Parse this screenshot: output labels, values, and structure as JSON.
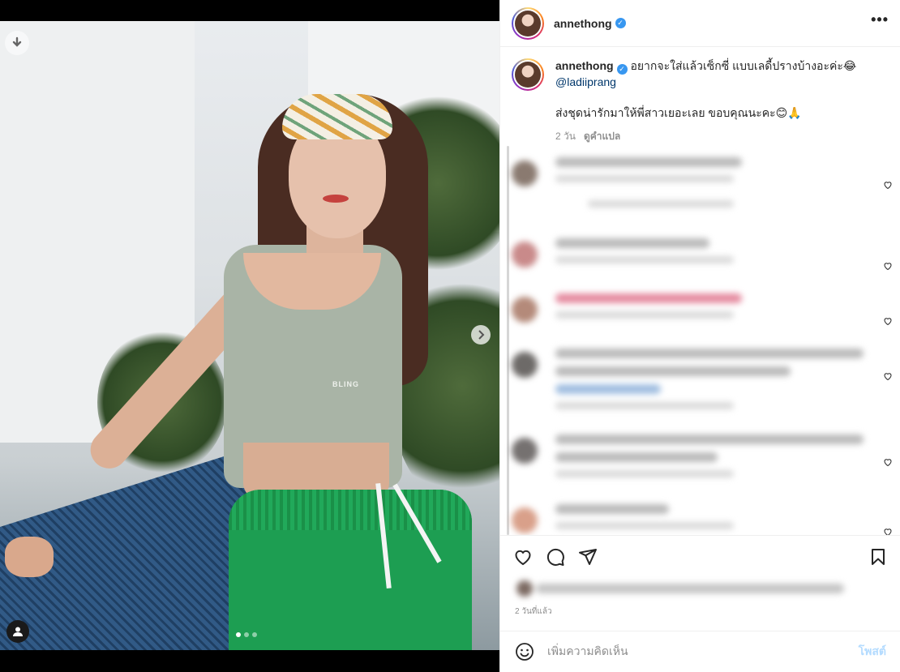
{
  "post": {
    "username": "annethong",
    "verified_badge": "✓",
    "more_glyph": "•••",
    "caption_line1": "อยากจะใส่แล้วเซ็กซี่ แบบเลดี้ปรางบ้างอะค่ะ😂",
    "mention": "@ladiiprang",
    "caption_line2": "ส่งชุดน่ารักมาให้พี่สาวเยอะเลย ขอบคุณนะคะ😊🙏",
    "age": "2 วัน",
    "translate": "ดูคำแปล",
    "media_brand_text": "BLING",
    "carousel_index": 1,
    "carousel_total": 3
  },
  "footer": {
    "timestamp": "2 วันที่แล้ว",
    "comment_placeholder": "เพิ่มความคิดเห็น",
    "post_button": "โพสต์"
  },
  "icons": {
    "download": "download-icon",
    "next": "chevron-right-icon",
    "tag": "user-tag-icon",
    "like": "heart-icon",
    "comment": "comment-icon",
    "share": "send-icon",
    "save": "bookmark-icon",
    "emoji": "emoji-icon",
    "more": "more-options-icon"
  },
  "colors": {
    "verified": "#3897f0",
    "link": "#00376b",
    "muted": "#8e8e8e",
    "post_button_disabled": "#b3dbff"
  }
}
